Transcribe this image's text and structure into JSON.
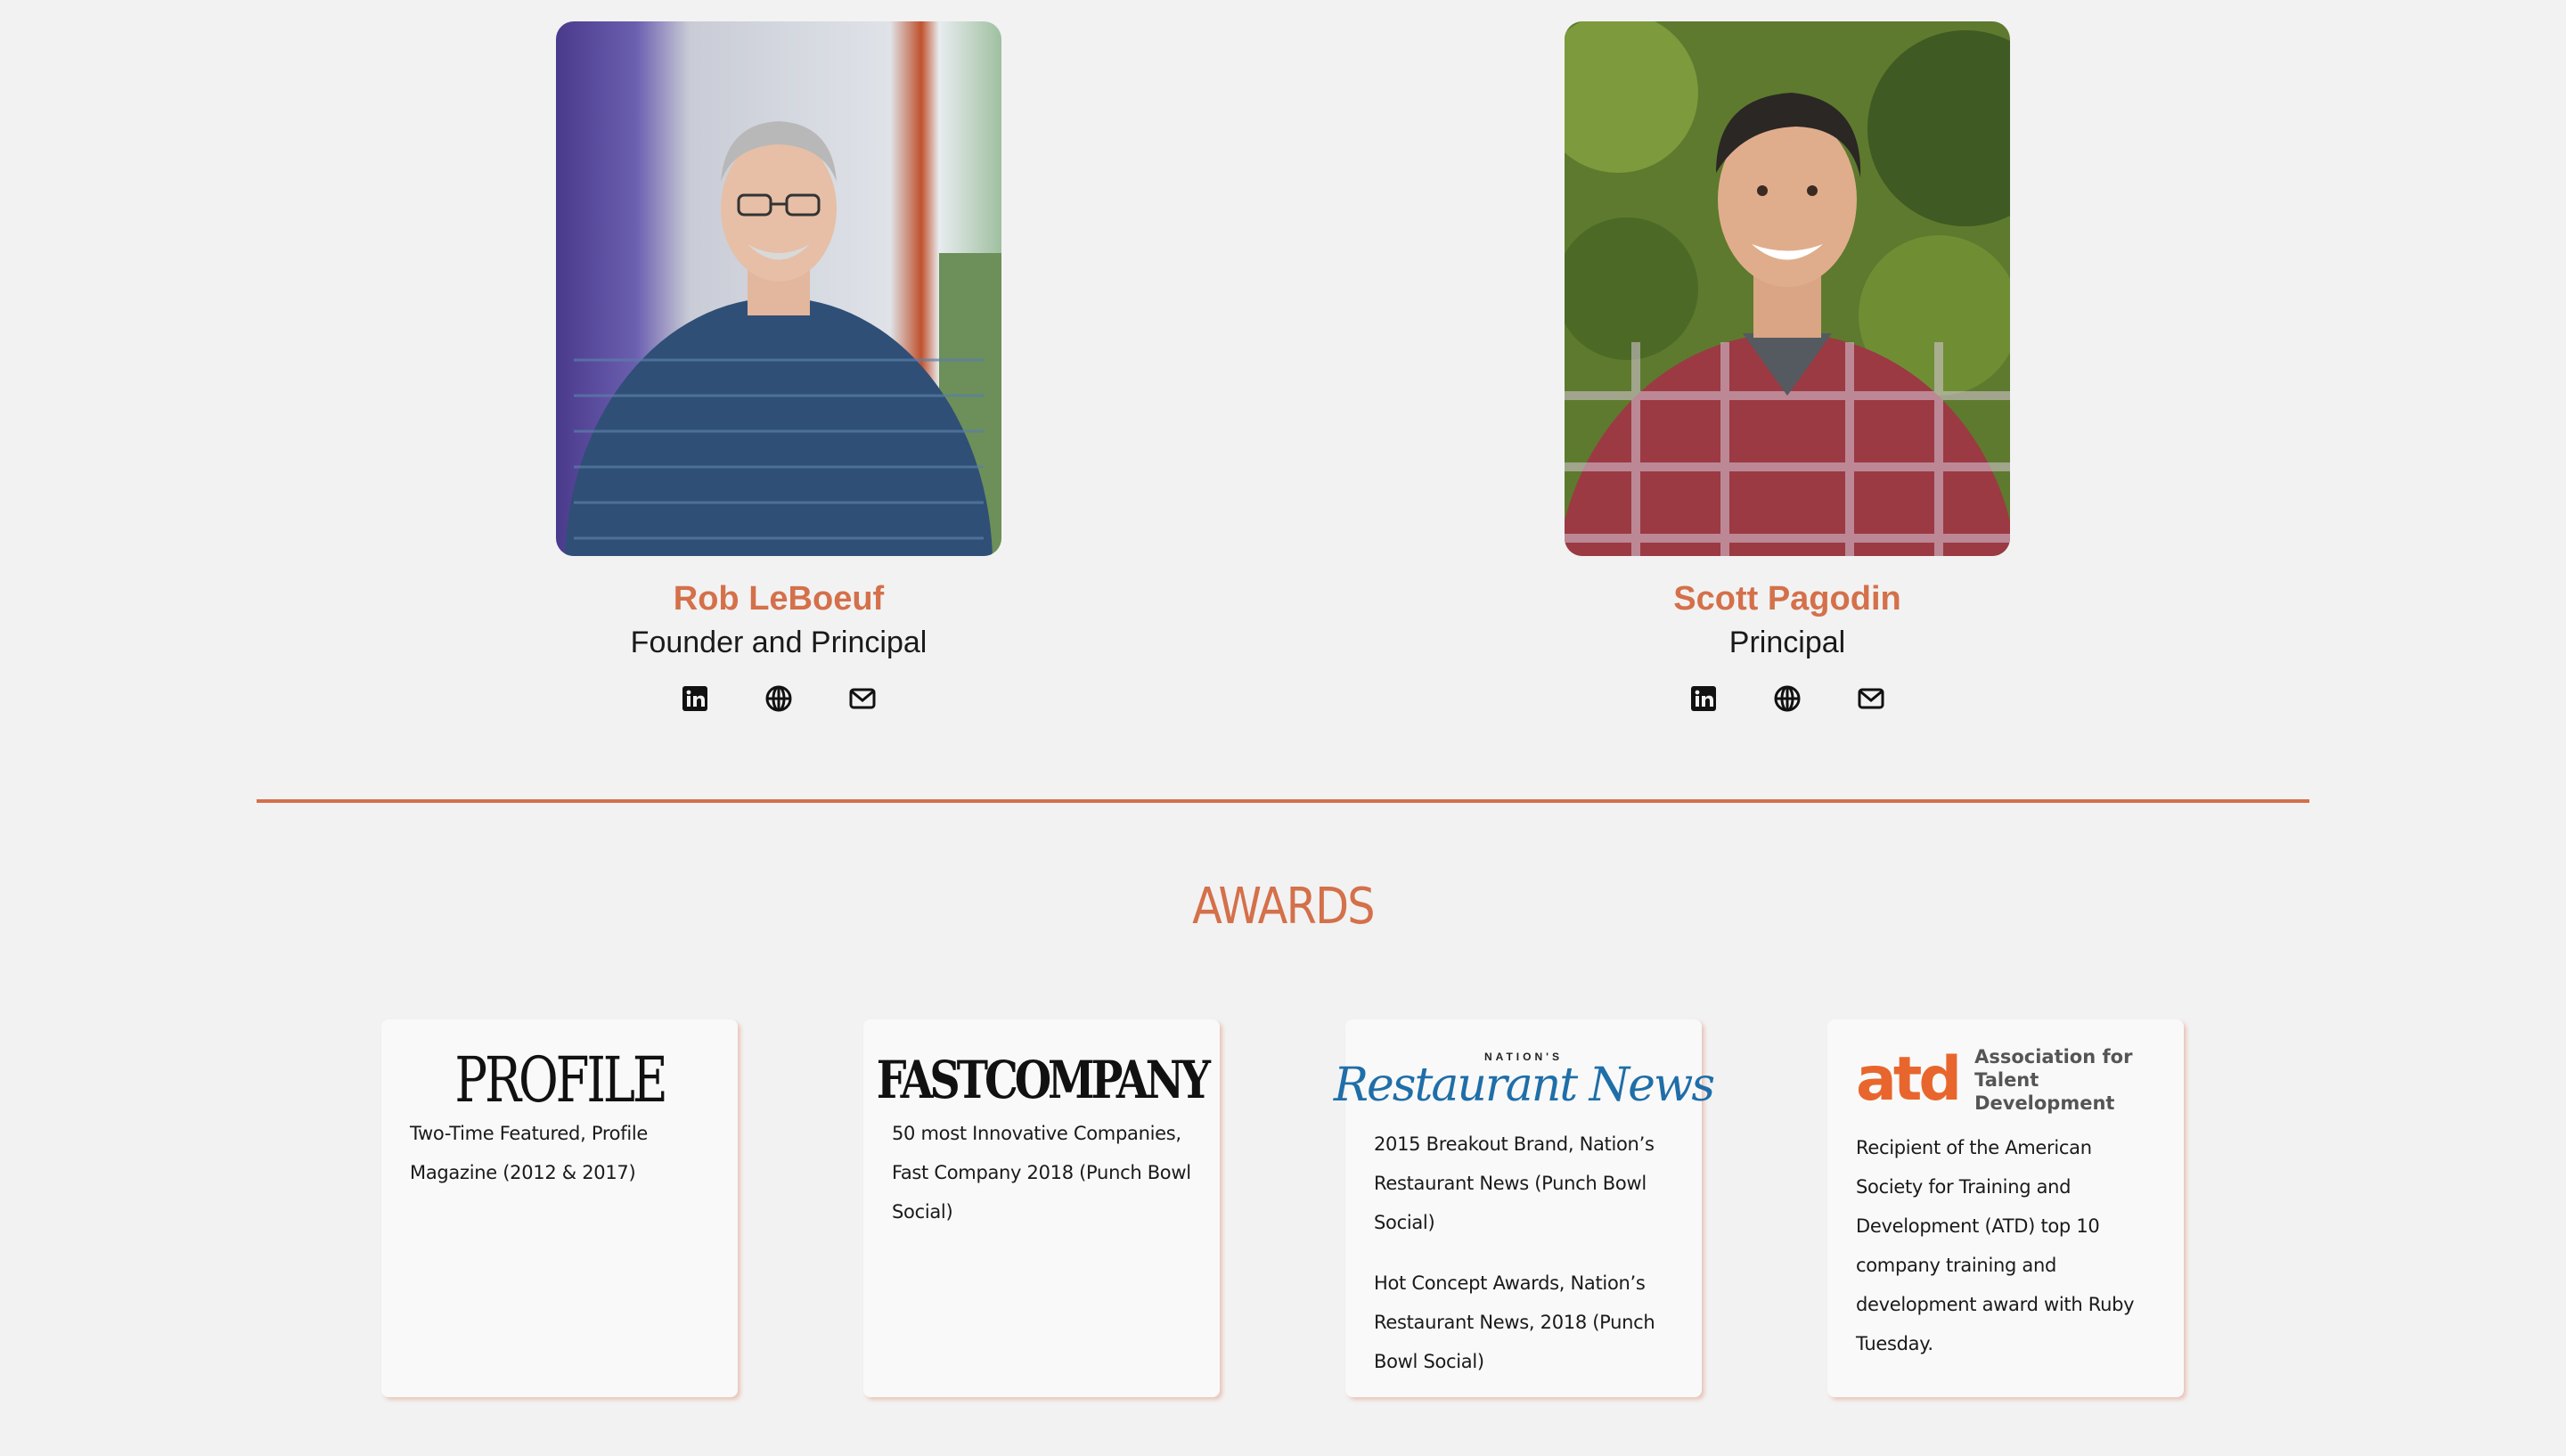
{
  "team": [
    {
      "name": "Rob LeBoeuf",
      "role": "Founder and Principal",
      "photo_alt": "Photo of Rob LeBoeuf"
    },
    {
      "name": "Scott Pagodin",
      "role": "Principal",
      "photo_alt": "Photo of Scott Pagodin"
    }
  ],
  "social_icons": [
    "linkedin-icon",
    "globe-icon",
    "email-icon"
  ],
  "awards": {
    "title": "AWARDS",
    "cards": [
      {
        "logo": "PROFILE",
        "texts": [
          "Two-Time Featured, Profile Magazine (2012 & 2017)"
        ]
      },
      {
        "logo": "FASTCOMPANY",
        "texts": [
          "50 most Innovative Companies, Fast Company 2018 (Punch Bowl Social)"
        ]
      },
      {
        "logo_top": "NATION'S",
        "logo": "Restaurant News",
        "texts": [
          "2015 Breakout Brand, Nation’s Restaurant News (Punch Bowl Social)",
          "Hot Concept Awards, Nation’s Restaurant News, 2018 (Punch Bowl Social)"
        ]
      },
      {
        "logo": "atd",
        "logo_text_1": "Association for",
        "logo_text_2": "Talent Development",
        "texts": [
          "Recipient of the American Society for Training and Development (ATD) top 10 company training and development award with Ruby Tuesday."
        ]
      }
    ]
  },
  "colors": {
    "accent": "#d4704a",
    "background": "#f2f2f2",
    "card": "#f9f9f9",
    "nrn_blue": "#1f6ea8",
    "atd_orange": "#e8662d"
  }
}
